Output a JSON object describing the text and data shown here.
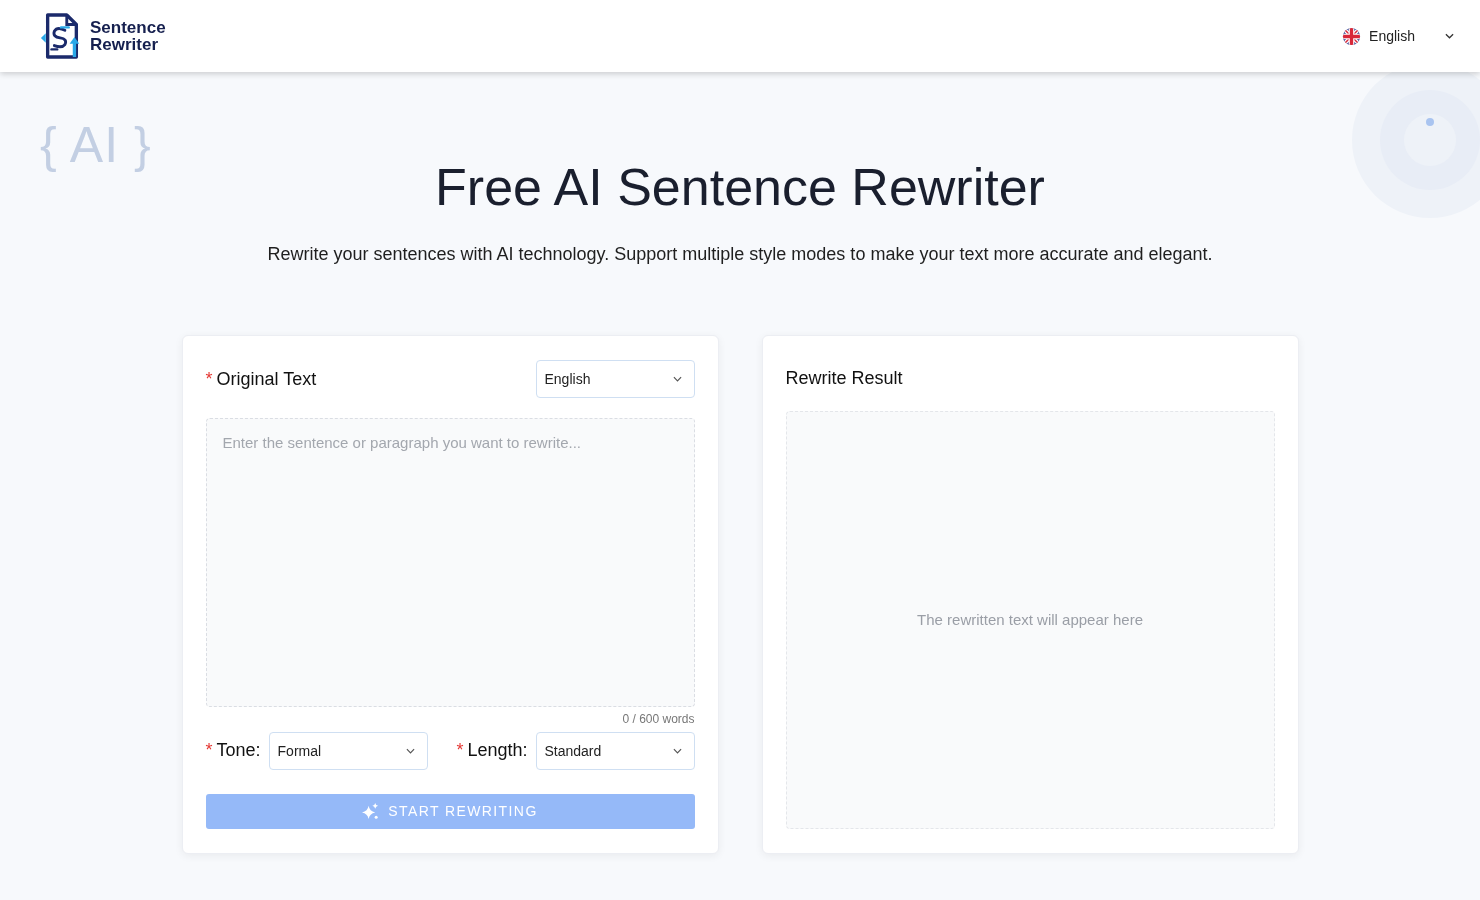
{
  "header": {
    "logo_text": "Sentence Rewriter",
    "language": {
      "label": "English"
    }
  },
  "decoration": {
    "text": "{ AI }"
  },
  "hero": {
    "title": "Free AI Sentence Rewriter",
    "subtitle": "Rewrite your sentences with AI technology. Support multiple style modes to make your text more accurate and elegant."
  },
  "input_panel": {
    "label": "Original Text",
    "required_mark": "*",
    "language_select": {
      "value": "English"
    },
    "textarea": {
      "placeholder": "Enter the sentence or paragraph you want to rewrite..."
    },
    "word_count": "0 / 600 words",
    "options": [
      {
        "label": "Tone:",
        "required_mark": "*",
        "value": "Formal"
      },
      {
        "label": "Length:",
        "required_mark": "*",
        "value": "Standard"
      }
    ],
    "submit_button": {
      "label": "START REWRITING",
      "disabled": true
    }
  },
  "result_panel": {
    "title": "Rewrite Result",
    "placeholder": "The rewritten text will appear here"
  }
}
